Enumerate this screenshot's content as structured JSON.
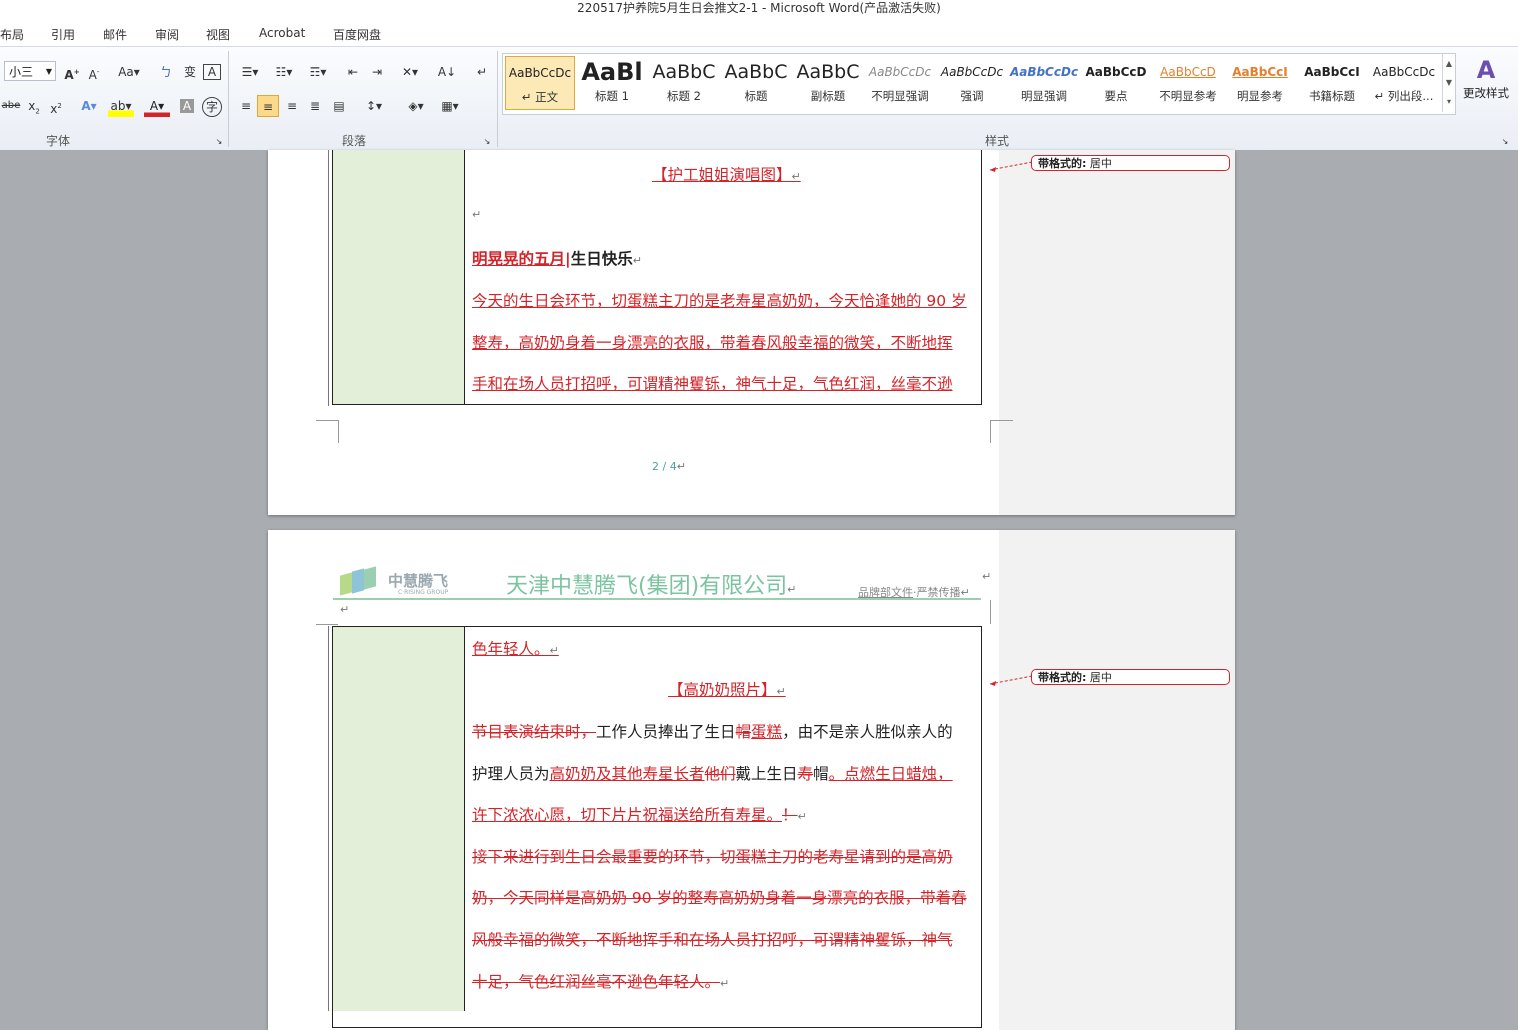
{
  "window": {
    "title": "220517护养院5月生日会推文2-1  -  Microsoft Word(产品激活失败)"
  },
  "menu": [
    "布局",
    "引用",
    "邮件",
    "审阅",
    "视图",
    "Acrobat",
    "百度网盘"
  ],
  "ribbon": {
    "font_size": "小三",
    "groups": {
      "font": "字体",
      "paragraph": "段落",
      "styles": "样式"
    },
    "styles": [
      {
        "preview": "AaBbCcDc",
        "name": "↵ 正文"
      },
      {
        "preview": "AaBl",
        "name": "标题 1"
      },
      {
        "preview": "AaBbC",
        "name": "标题 2"
      },
      {
        "preview": "AaBbC",
        "name": "标题"
      },
      {
        "preview": "AaBbC",
        "name": "副标题"
      },
      {
        "preview": "AaBbCcDc",
        "name": "不明显强调"
      },
      {
        "preview": "AaBbCcDc",
        "name": "强调"
      },
      {
        "preview": "AaBbCcDc",
        "name": "明显强调"
      },
      {
        "preview": "AaBbCcD",
        "name": "要点"
      },
      {
        "preview": "AaBbCcD",
        "name": "不明显参考"
      },
      {
        "preview": "AaBbCcI",
        "name": "明显参考"
      },
      {
        "preview": "AaBbCcI",
        "name": "书籍标题"
      },
      {
        "preview": "AaBbCcDc",
        "name": "↵ 列出段..."
      }
    ],
    "change_styles": "更改样式"
  },
  "page1": {
    "caption": "【护工姐姐演唱图】",
    "heading_bold": "明晃晃的五月",
    "heading_rest": "生日快乐",
    "lines": [
      "今天的生日会环节，切蛋糕主刀的是老寿星高奶奶，今天恰逢她的 90 岁",
      "整寿，高奶奶身着一身漂亮的衣服，带着春风般幸福的微笑，不断地挥",
      "手和在场人员打招呼，可谓精神矍铄，神气十足，气色红润，丝毫不逊"
    ],
    "page_num": "2 / 4",
    "balloon_label": "带格式的:",
    "balloon_value": "居中"
  },
  "page2": {
    "logo_cn": "中慧腾飞",
    "logo_en": "C·RISING GROUP",
    "company": "天津中慧腾飞(集团)有限公司",
    "header_note_a": "品牌部文件",
    "header_note_b": "·严禁传播",
    "first_line": "色年轻人。",
    "caption": "【高奶奶照片】",
    "l1_del": "节目表演结束时，",
    "l1_a": "工作人员捧出了生日",
    "l1_del2": "帽",
    "l1_ins": "蛋糕",
    "l1_b": "，由不是亲人胜似亲人的",
    "l2_a": "护理人员为",
    "l2_ins": "高奶奶及其他寿星长者",
    "l2_del": "他们",
    "l2_b": "戴上生日",
    "l2_del2": "寿",
    "l2_c": "帽",
    "l2_ins2": "。点燃生日蜡烛，",
    "l3_ins": "许下浓浓心愿，切下片片祝福送给所有寿星。",
    "l3_del": "！",
    "del_lines": [
      "接下来进行到生日会最重要的环节，切蛋糕主刀的老寿星请到的是高奶",
      "奶，今天同样是高奶奶 90 岁的整寿高奶奶身着一身漂亮的衣服，带着春",
      "风般幸福的微笑，不断地挥手和在场人员打招呼，可谓精神矍铄，神气",
      "十足，气色红润丝毫不逊色年轻人。"
    ],
    "balloon_label": "带格式的:",
    "balloon_value": "居中"
  }
}
